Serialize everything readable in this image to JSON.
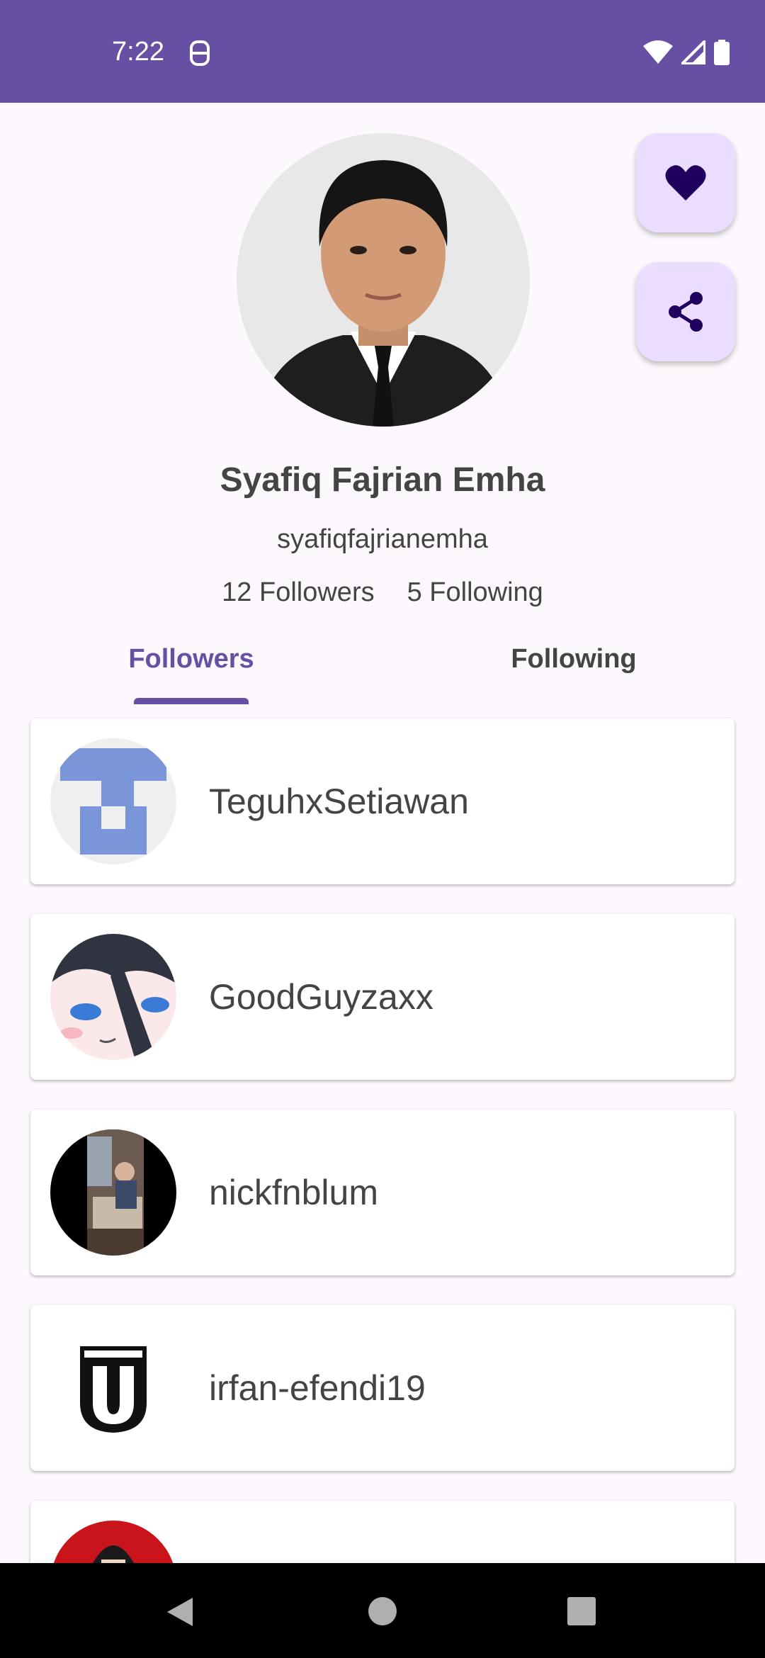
{
  "status_bar": {
    "time": "7:22",
    "background_color": "#6750a4",
    "icons": [
      "notification-icon",
      "wifi-icon",
      "signal-icon",
      "battery-icon"
    ]
  },
  "profile": {
    "name": "Syafiq Fajrian Emha",
    "username": "syafiqfajrianemha",
    "followers_label": "12 Followers",
    "following_label": "5 Following"
  },
  "actions": {
    "favorite_icon": "heart-icon",
    "share_icon": "share-icon",
    "fab_color": "#eaddff"
  },
  "tabs": [
    {
      "label": "Followers",
      "selected": true
    },
    {
      "label": "Following",
      "selected": false
    }
  ],
  "followers": [
    {
      "login": "TeguhxSetiawan"
    },
    {
      "login": "GoodGuyzaxx"
    },
    {
      "login": "nickfnblum"
    },
    {
      "login": "irfan-efendi19"
    },
    {
      "login": ""
    }
  ],
  "theme": {
    "primary": "#6750a4",
    "text": "#444444",
    "background": "#fdf8fd"
  },
  "nav": {
    "icons": [
      "back-icon",
      "home-icon",
      "recents-icon"
    ]
  }
}
